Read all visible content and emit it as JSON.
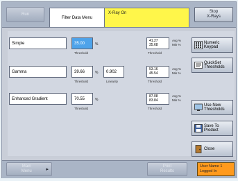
{
  "topbar": {
    "left_button": "Run",
    "tab_label": "Filter Data Menu",
    "status_message": "X-Ray On",
    "right_button_line1": "Stop",
    "right_button_line2": "X-Rays"
  },
  "filters": [
    {
      "name": "Simple",
      "threshold": "35.00",
      "threshold_unit": "%",
      "threshold_caption": "Threshold",
      "readout_line1": "41.27",
      "readout_line2": "35.68",
      "avg_label": "Avg %",
      "min_label": "Min %",
      "readout_caption": "Threshold"
    },
    {
      "name": "Gamma",
      "threshold": "39.66",
      "threshold_unit": "%",
      "threshold_caption": "Threshold",
      "linearity": "0.902",
      "linearity_caption": "Linearity",
      "readout_line1": "53.16",
      "readout_line2": "45.54",
      "avg_label": "Avg %",
      "min_label": "Min %",
      "readout_caption": "Threshold"
    },
    {
      "name": "Enhanced Gradient",
      "threshold": "70.55",
      "threshold_unit": "%",
      "threshold_caption": "Threshold",
      "readout_line1": "87.08",
      "readout_line2": "83.84",
      "avg_label": "Avg %",
      "min_label": "Min %",
      "readout_caption": "Threshold"
    }
  ],
  "side_buttons": {
    "numeric_keypad_1": "Numeric",
    "numeric_keypad_2": "Keypad",
    "quickset_1": "QuickSet",
    "quickset_2": "Thresholds",
    "use_new_1": "Use New",
    "use_new_2": "Thresholds",
    "save_1": "Save To",
    "save_2": "Product",
    "close": "Close"
  },
  "bottombar": {
    "left_button_1": "Main",
    "left_button_2": "Menu",
    "arrow": "▸",
    "middle_button_1": "Print",
    "middle_button_2": "Results",
    "user_line1": "User Name 1",
    "user_line2": "Logged In"
  },
  "colors": {
    "selected_field": "#4ea3ea",
    "status_banner": "#fff64a",
    "user_badge": "#ff9a1d"
  }
}
